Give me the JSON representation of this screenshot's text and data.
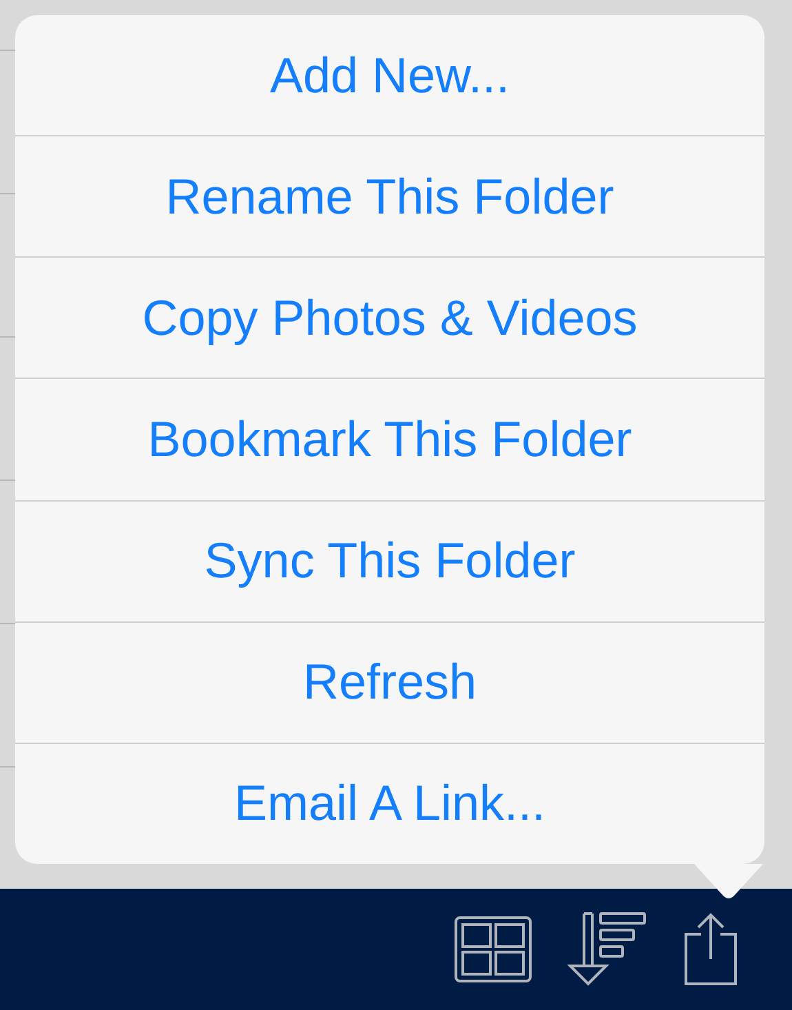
{
  "menu": {
    "items": [
      {
        "label": "Add New..."
      },
      {
        "label": "Rename This Folder"
      },
      {
        "label": "Copy Photos & Videos"
      },
      {
        "label": "Bookmark This Folder"
      },
      {
        "label": "Sync This Folder"
      },
      {
        "label": "Refresh"
      },
      {
        "label": "Email A Link..."
      }
    ]
  },
  "toolbar": {
    "buttons": [
      {
        "kind": "grid"
      },
      {
        "kind": "sort"
      },
      {
        "kind": "share"
      }
    ]
  }
}
